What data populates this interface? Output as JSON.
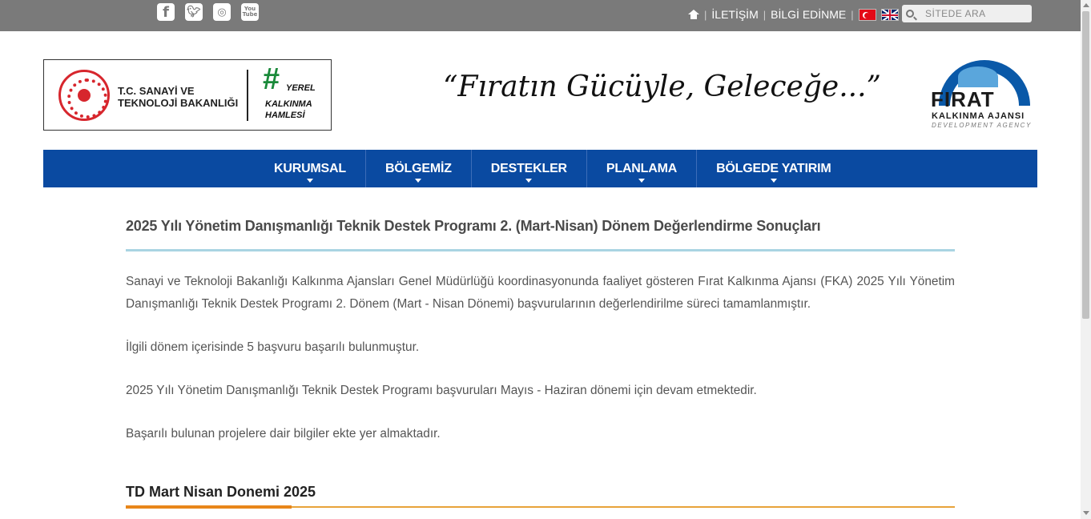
{
  "topbar": {
    "social": [
      {
        "name": "facebook",
        "glyph": "f"
      },
      {
        "name": "twitter",
        "glyph": "t"
      },
      {
        "name": "instagram",
        "glyph": "◎"
      },
      {
        "name": "youtube",
        "glyph": "You Tube"
      }
    ],
    "links": {
      "contact": "İLETİŞİM",
      "info": "BİLGİ EDİNME"
    },
    "search_placeholder": "SİTEDE ARA"
  },
  "header": {
    "ministry": "T.C. SANAYİ VE\nTEKNOLOJİ BAKANLIĞI",
    "hashtag": "#",
    "campaign_first": "YEREL",
    "campaign_rest": "KALKINMA\nHAMLESİ",
    "slogan": "“Fıratın Gücüyle, Geleceğe...”",
    "agency_name": "FIRAT",
    "agency_sub": "KALKINMA AJANSI",
    "agency_sub_en": "DEVELOPMENT AGENCY"
  },
  "nav": {
    "items": [
      {
        "label": "KURUMSAL"
      },
      {
        "label": "BÖLGEMİZ"
      },
      {
        "label": "DESTEKLER"
      },
      {
        "label": "PLANLAMA"
      },
      {
        "label": "BÖLGEDE YATIRIM"
      }
    ]
  },
  "article": {
    "title": "2025 Yılı Yönetim Danışmanlığı Teknik Destek Programı 2. (Mart-Nisan) Dönem Değerlendirme Sonuçları",
    "paragraphs": [
      "Sanayi ve Teknoloji Bakanlığı Kalkınma Ajansları Genel Müdürlüğü koordinasyonunda faaliyet gösteren Fırat Kalkınma Ajansı (FKA) 2025 Yılı Yönetim Danışmanlığı Teknik Destek Programı 2. Dönem (Mart - Nisan Dönemi) başvurularının değerlendirilme süreci tamamlanmıştır.",
      "İlgili dönem içerisinde 5 başvuru başarılı bulunmuştur.",
      "2025 Yılı Yönetim Danışmanlığı Teknik Destek Programı başvuruları Mayıs - Haziran dönemi için devam etmektedir.",
      "Başarılı bulunan projelere dair bilgiler ekte yer almaktadır."
    ],
    "section_title": "TD Mart Nisan Donemi 2025"
  },
  "colors": {
    "topbar": "#7a7a7a",
    "nav": "#0a4aa1",
    "title_rule": "#a9d4e2",
    "section_rule": "#e8861a"
  }
}
